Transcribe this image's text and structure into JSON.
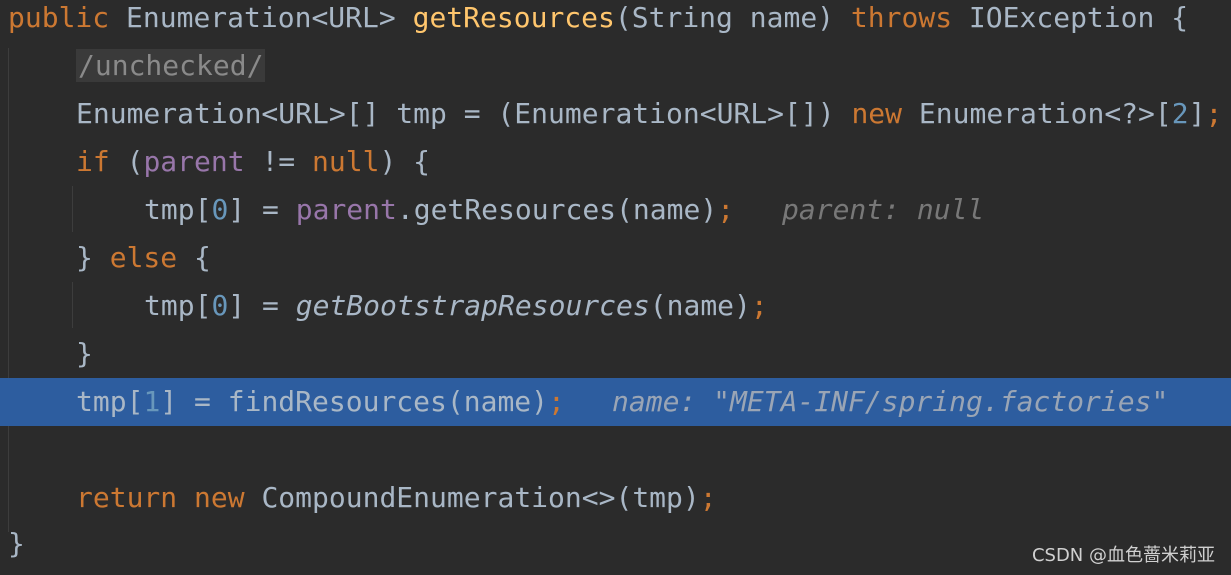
{
  "lines": {
    "l1": {
      "kw1": "public",
      "t1": " Enumeration<URL> ",
      "fn": "getResources",
      "t2": "(String name) ",
      "kw2": "throws",
      "t3": " IOException {"
    },
    "l2": {
      "comment": "/unchecked/"
    },
    "l3": {
      "t1": "Enumeration<URL>[] tmp = (Enumeration<URL>[]) ",
      "kw1": "new",
      "t2": " Enumeration<?>[",
      "num": "2",
      "t3": "]",
      "semi": ";"
    },
    "l4": {
      "kw1": "if",
      "t1": " (",
      "field": "parent",
      "t2": " != ",
      "kw2": "null",
      "t3": ") {"
    },
    "l5": {
      "t1": "tmp[",
      "num": "0",
      "t2": "] = ",
      "field": "parent",
      "t3": ".getResources(name)",
      "semi": ";",
      "hint": "parent: null"
    },
    "l6": {
      "t1": "} ",
      "kw1": "else",
      "t2": " {"
    },
    "l7": {
      "t1": "tmp[",
      "num": "0",
      "t2": "] = ",
      "fn_italic": "getBootstrapResources",
      "t3": "(name)",
      "semi": ";"
    },
    "l8": {
      "t1": "}"
    },
    "l9": {
      "t1": "tmp[",
      "num": "1",
      "t2": "] = findResources(name)",
      "semi": ";",
      "hint": "name: \"META-INF/spring.factories\""
    },
    "l11": {
      "kw1": "return",
      "t1": " ",
      "kw2": "new",
      "t2": " CompoundEnumeration<>(tmp)",
      "semi": ";"
    },
    "l12": {
      "t1": "}"
    }
  },
  "watermark": "CSDN @血色蔷米莉亚",
  "colors": {
    "background": "#2b2b2b",
    "text": "#a9b7c6",
    "keyword": "#cc7832",
    "function": "#ffc66d",
    "number": "#6897bb",
    "field": "#9876aa",
    "hint": "#787878",
    "highlight": "#2d5d9f"
  }
}
